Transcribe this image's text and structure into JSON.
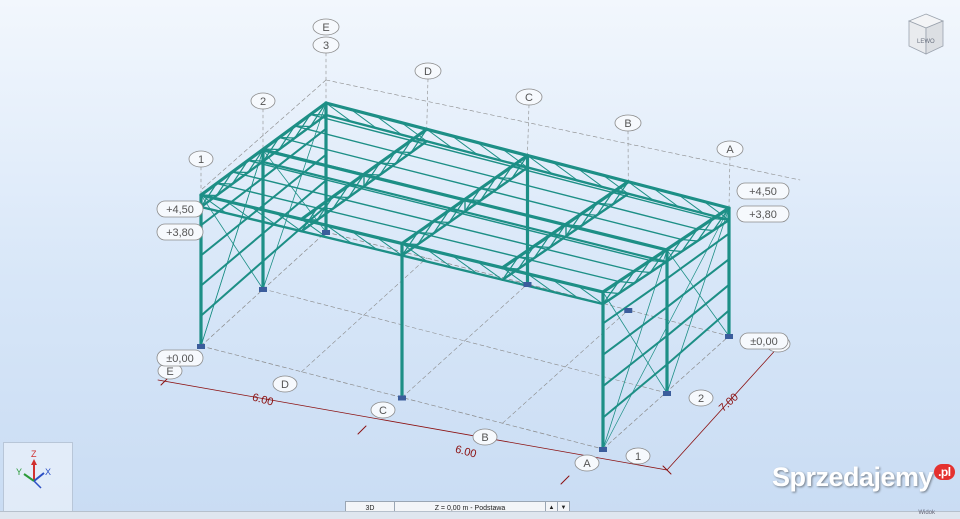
{
  "app": {
    "view_cube_label": "LEWO",
    "view_type": "3D",
    "active_level": "Z = 0,00 m - Podstawa",
    "status_text": "Widok"
  },
  "grid_axes": {
    "letters": [
      "E",
      "D",
      "C",
      "B",
      "A"
    ],
    "numbers": [
      "1",
      "2",
      "3"
    ],
    "back_labels": {
      "E": "E",
      "three": "3",
      "D": "D",
      "C": "C",
      "B": "B",
      "A": "A",
      "two": "2",
      "one": "1"
    },
    "front_labels": {
      "E": "E",
      "D": "D",
      "C": "C",
      "B": "B",
      "A": "A",
      "one": "1",
      "two": "2",
      "three": "3"
    }
  },
  "levels": {
    "left_top": "+4,50",
    "left_mid": "+3,80",
    "left_base": "±0,00",
    "right_top": "+4,50",
    "right_mid": "+3,80",
    "right_base": "±0,00"
  },
  "dimensions": {
    "span_1": "6.00",
    "span_2": "6.00",
    "width": "7.00"
  },
  "triad": {
    "x": "X",
    "y": "Y",
    "z": "Z"
  },
  "watermark": {
    "name": "Sprzedajemy",
    "tld": ".pl"
  },
  "colors": {
    "structure": "#1d8f86",
    "dimension": "#8b1010",
    "grid": "#8a8a8a",
    "support": "#3b5d9c"
  }
}
